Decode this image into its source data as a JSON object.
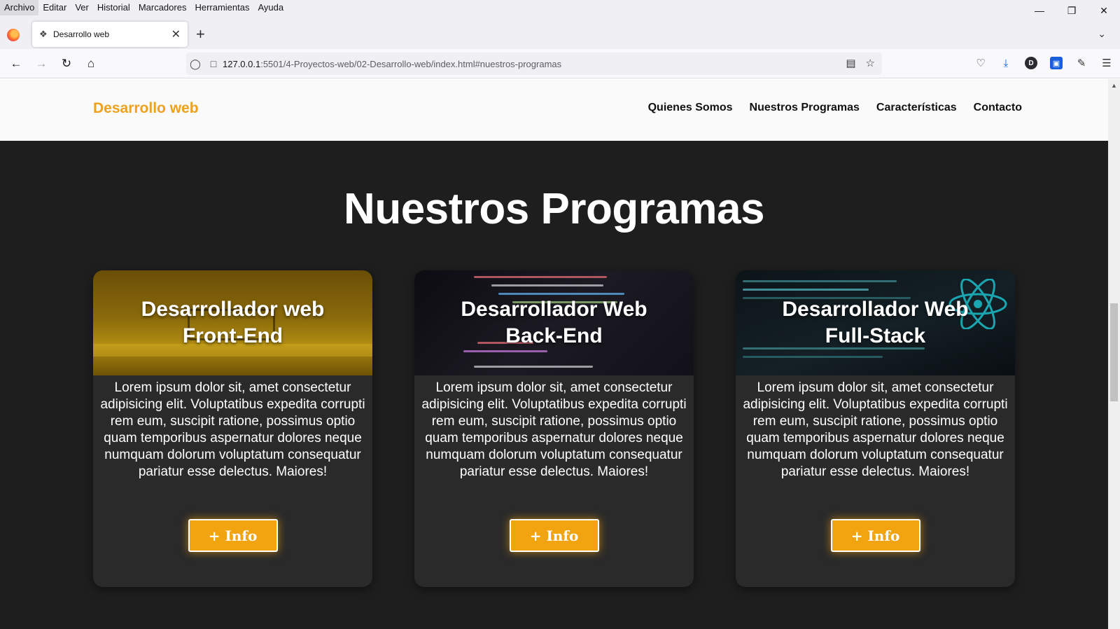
{
  "browser": {
    "menu": [
      "Archivo",
      "Editar",
      "Ver",
      "Historial",
      "Marcadores",
      "Herramientas",
      "Ayuda"
    ],
    "tab_title": "Desarrollo web",
    "url_host": "127.0.0.1",
    "url_rest": ":5501/4-Proyectos-web/02-Desarrollo-web/index.html#nuestros-programas",
    "account_initial": "D"
  },
  "site": {
    "logo": "Desarrollo web",
    "nav": [
      "Quienes Somos",
      "Nuestros Programas",
      "Características",
      "Contacto"
    ],
    "accent_color": "#eea11c"
  },
  "section": {
    "title": "Nuestros Programas"
  },
  "cards": [
    {
      "title_line1": "Desarrollador web",
      "title_line2": "Front-End",
      "text": "Lorem ipsum dolor sit, amet consectetur adipisicing elit. Voluptatibus expedita corrupti rem eum, suscipit ratione, possimus optio quam temporibus aspernatur dolores neque numquam dolorum voluptatum consequatur pariatur esse delectus. Maiores!",
      "button": "+ Info"
    },
    {
      "title_line1": "Desarrollador Web",
      "title_line2": "Back-End",
      "text": "Lorem ipsum dolor sit, amet consectetur adipisicing elit. Voluptatibus expedita corrupti rem eum, suscipit ratione, possimus optio quam temporibus aspernatur dolores neque numquam dolorum voluptatum consequatur pariatur esse delectus. Maiores!",
      "button": "+ Info"
    },
    {
      "title_line1": "Desarrollador Web",
      "title_line2": "Full-Stack",
      "text": "Lorem ipsum dolor sit, amet consectetur adipisicing elit. Voluptatibus expedita corrupti rem eum, suscipit ratione, possimus optio quam temporibus aspernatur dolores neque numquam dolorum voluptatum consequatur pariatur esse delectus. Maiores!",
      "button": "+ Info"
    }
  ]
}
